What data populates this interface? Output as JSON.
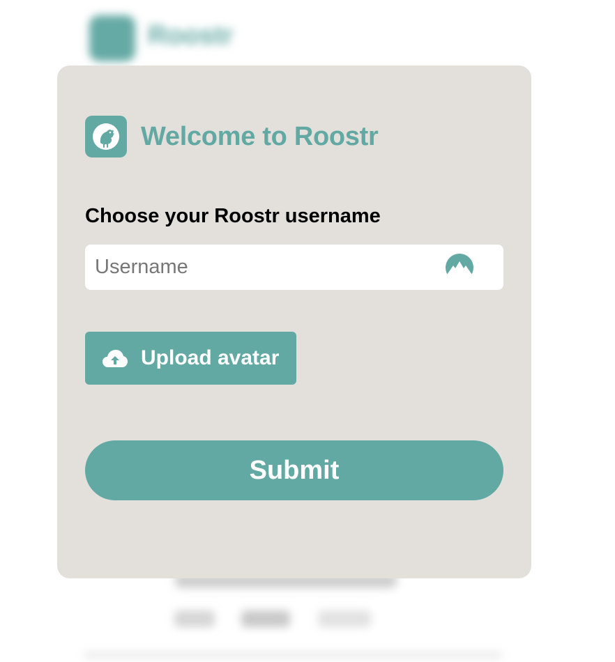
{
  "background": {
    "brand_name": "Roostr"
  },
  "modal": {
    "title": "Welcome to Roostr",
    "username_label": "Choose your Roostr username",
    "username_placeholder": "Username",
    "username_value": "",
    "upload_label": "Upload avatar",
    "submit_label": "Submit"
  },
  "icons": {
    "logo": "rooster-icon",
    "input_adornment": "mountain-peak-icon",
    "upload": "cloud-upload-icon"
  },
  "colors": {
    "accent": "#62a8a3",
    "modal_background": "#e3e0dc",
    "input_background": "#ffffff",
    "label_text": "#000000",
    "button_text": "#ffffff"
  }
}
